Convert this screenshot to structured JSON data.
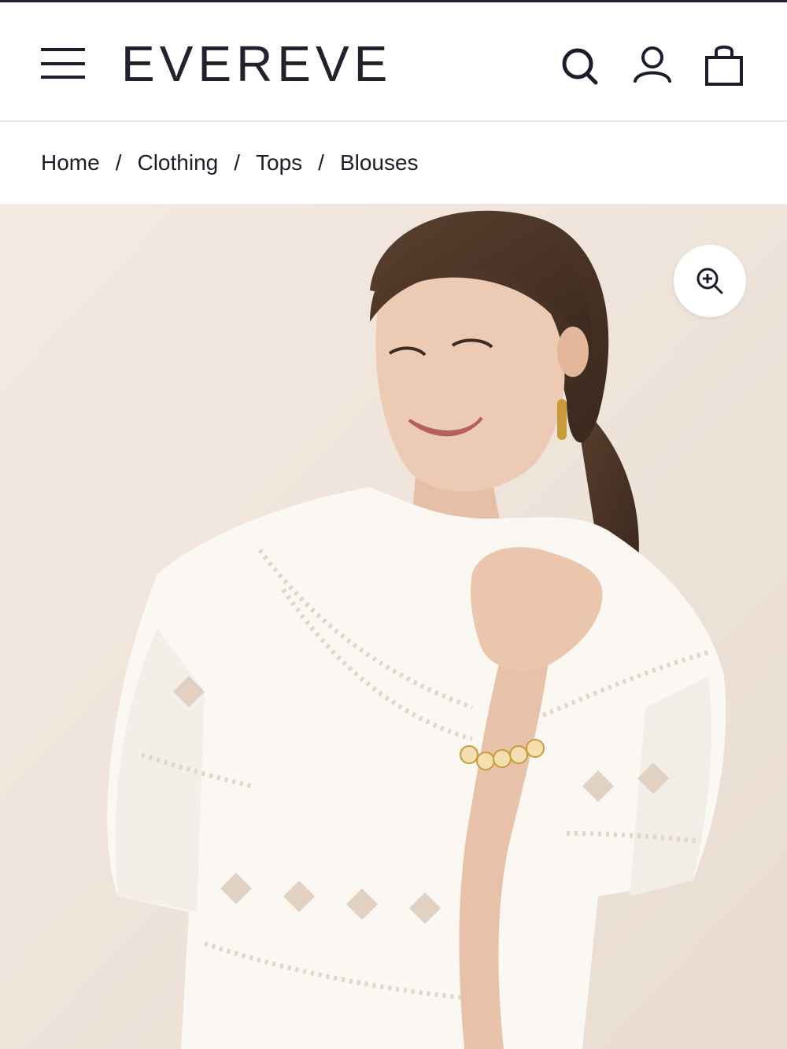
{
  "header": {
    "logo_text": "EVEREVE",
    "menu_icon": "hamburger-menu-icon",
    "search_icon": "search-icon",
    "account_icon": "user-account-icon",
    "bag_icon": "shopping-bag-icon"
  },
  "breadcrumb": {
    "items": [
      {
        "label": "Home"
      },
      {
        "label": "Clothing"
      },
      {
        "label": "Tops"
      },
      {
        "label": "Blouses"
      }
    ],
    "separator": "/"
  },
  "hero": {
    "zoom_icon": "zoom-in-icon",
    "colors": {
      "background": "#efe5dc",
      "blouse": "#fbf8f4",
      "hair": "#4a3326",
      "skin": "#e8c4ad"
    }
  }
}
